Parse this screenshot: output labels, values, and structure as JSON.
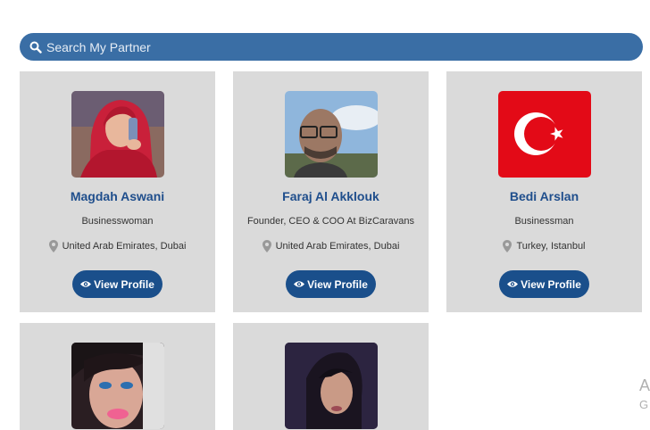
{
  "search": {
    "placeholder": "Search My Partner"
  },
  "partners": [
    {
      "name": "Magdah Aswani",
      "title": "Businesswoman",
      "location": "United Arab Emirates, Dubai",
      "button": "View Profile",
      "avatar": "woman-red-hijab-photo"
    },
    {
      "name": "Faraj Al Akklouk",
      "title": "Founder, CEO & COO At BizCaravans",
      "location": "United Arab Emirates, Dubai",
      "button": "View Profile",
      "avatar": "man-glasses-photo"
    },
    {
      "name": "Bedi Arslan",
      "title": "Businessman",
      "location": "Turkey, Istanbul",
      "button": "View Profile",
      "avatar": "turkish-flag"
    }
  ],
  "partial_partners": [
    {
      "avatar": "woman-dark-hair-photo"
    },
    {
      "avatar": "woman-long-hair-photo"
    }
  ],
  "side_text": {
    "line1": "A",
    "line2": "G"
  }
}
